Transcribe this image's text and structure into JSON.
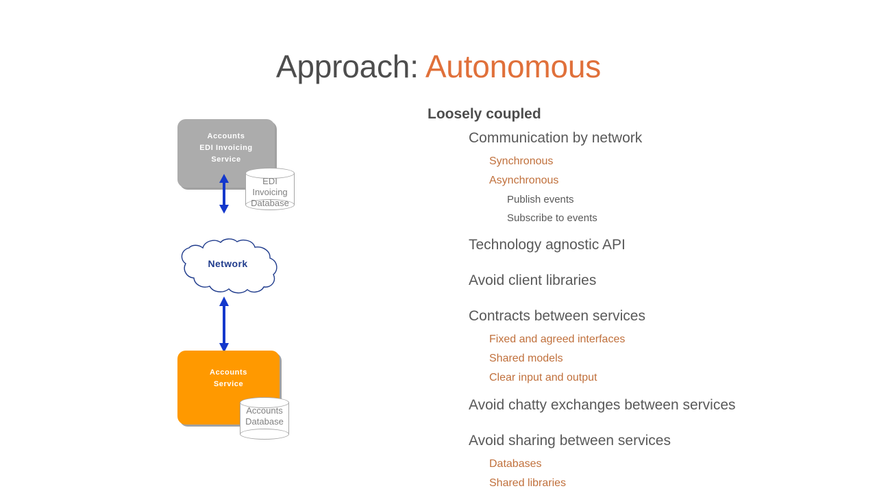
{
  "slide": {
    "title_main": "Approach: ",
    "title_accent": "Autonomous",
    "accent_color": "#e0703a",
    "body_color": "#595959",
    "heading_color": "#4d4d4d",
    "sub_accent_color": "#c0703c"
  },
  "diagram": {
    "edi_service": {
      "label": "Accounts\nEDI Invoicing\nService",
      "fill": "#acacac",
      "text_color": "#ffffff"
    },
    "edi_database": {
      "label": "EDI\nInvoicing\nDatabase",
      "fill": "#ffffff",
      "text_color": "#808080"
    },
    "network": {
      "label": "Network",
      "outline": "#1f3b8c",
      "text_color": "#1f3b8c"
    },
    "accounts_service": {
      "label": "Accounts\nService",
      "fill": "#ff9900",
      "text_color": "#ffffff"
    },
    "accounts_database": {
      "label": "Accounts\nDatabase",
      "fill": "#ffffff",
      "text_color": "#808080"
    },
    "arrow_color": "#1438cc",
    "arrow_top_name": "bidirectional arrow service to network",
    "arrow_bottom_name": "bidirectional arrow network to accounts service"
  },
  "bullets": [
    {
      "level": 1,
      "text": "Loosely coupled"
    },
    {
      "level": 2,
      "text": "Communication by network"
    },
    {
      "level": 3,
      "text": "Synchronous"
    },
    {
      "level": 3,
      "text": "Asynchronous"
    },
    {
      "level": 4,
      "text": "Publish events"
    },
    {
      "level": 4,
      "text": "Subscribe to events"
    },
    {
      "level": 2,
      "text": "Technology agnostic API"
    },
    {
      "level": 2,
      "text": "Avoid client libraries"
    },
    {
      "level": 2,
      "text": "Contracts between services"
    },
    {
      "level": 3,
      "text": "Fixed and agreed interfaces"
    },
    {
      "level": 3,
      "text": "Shared models"
    },
    {
      "level": 3,
      "text": "Clear input and output"
    },
    {
      "level": 2,
      "text": "Avoid chatty exchanges between services"
    },
    {
      "level": 2,
      "text": "Avoid sharing between services"
    },
    {
      "level": 3,
      "text": "Databases"
    },
    {
      "level": 3,
      "text": "Shared libraries"
    }
  ]
}
